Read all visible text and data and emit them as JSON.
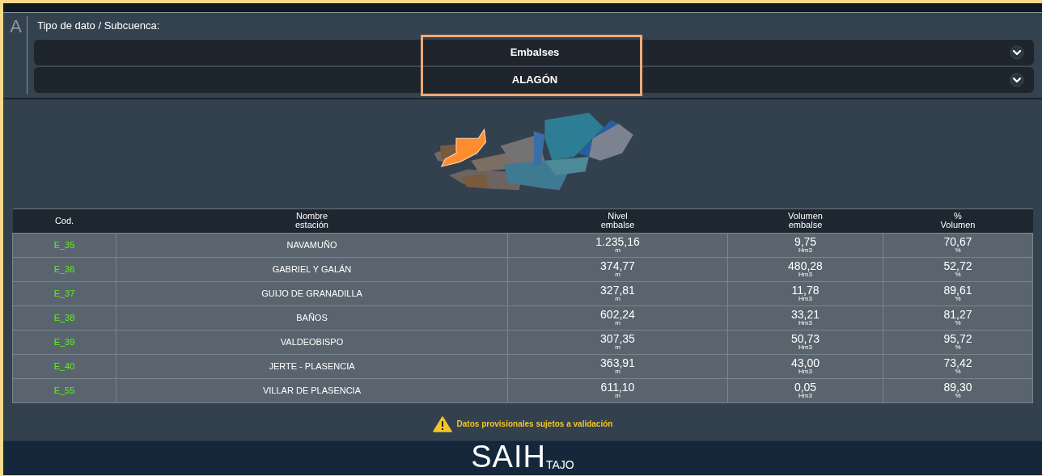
{
  "filter": {
    "letter": "A",
    "label": "Tipo de dato / Subcuenca:",
    "selects": [
      {
        "value": "Embalses"
      },
      {
        "value": "ALAGÓN"
      }
    ]
  },
  "table": {
    "columns": [
      [
        "Cod."
      ],
      [
        "Nombre",
        "estación"
      ],
      [
        "Nivel",
        "embalse"
      ],
      [
        "Volumen",
        "embalse"
      ],
      [
        "%",
        "Volumen"
      ]
    ],
    "rows": [
      {
        "code": "E_35",
        "name": "NAVAMUÑO",
        "level": "1.235,16",
        "level_unit": "m",
        "volume": "9,75",
        "volume_unit": "Hm3",
        "percent": "70,67",
        "percent_unit": "%"
      },
      {
        "code": "E_36",
        "name": "GABRIEL Y GALÁN",
        "level": "374,77",
        "level_unit": "m",
        "volume": "480,28",
        "volume_unit": "Hm3",
        "percent": "52,72",
        "percent_unit": "%"
      },
      {
        "code": "E_37",
        "name": "GUIJO DE GRANADILLA",
        "level": "327,81",
        "level_unit": "m",
        "volume": "11,78",
        "volume_unit": "Hm3",
        "percent": "89,61",
        "percent_unit": "%"
      },
      {
        "code": "E_38",
        "name": "BAÑOS",
        "level": "602,24",
        "level_unit": "m",
        "volume": "33,21",
        "volume_unit": "Hm3",
        "percent": "81,27",
        "percent_unit": "%"
      },
      {
        "code": "E_39",
        "name": "VALDEOBISPO",
        "level": "307,35",
        "level_unit": "m",
        "volume": "50,73",
        "volume_unit": "Hm3",
        "percent": "95,72",
        "percent_unit": "%"
      },
      {
        "code": "E_40",
        "name": "JERTE - PLASENCIA",
        "level": "363,91",
        "level_unit": "m",
        "volume": "43,00",
        "volume_unit": "Hm3",
        "percent": "73,42",
        "percent_unit": "%"
      },
      {
        "code": "E_55",
        "name": "VILLAR DE PLASENCIA",
        "level": "611,10",
        "level_unit": "m",
        "volume": "0,05",
        "volume_unit": "Hm3",
        "percent": "89,30",
        "percent_unit": "%"
      }
    ]
  },
  "notice": "Datos provisionales sujetos a validación",
  "footer": {
    "logo_main": "SAIH",
    "logo_sub": "TAJO"
  }
}
